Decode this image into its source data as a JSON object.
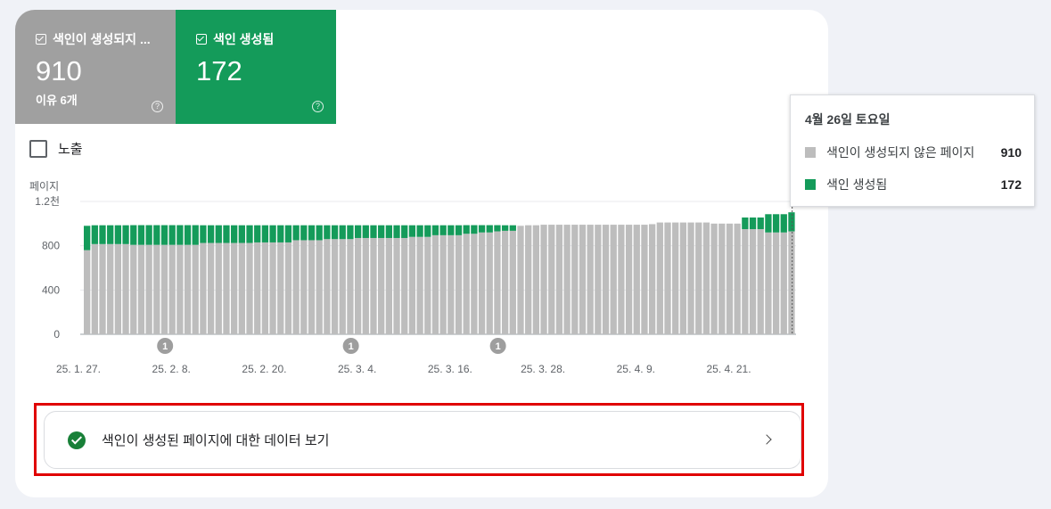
{
  "metrics": {
    "not_indexed": {
      "label": "색인이 생성되지 ...",
      "value": "910",
      "sub": "이유 6개",
      "help": "?"
    },
    "indexed": {
      "label": "색인 생성됨",
      "value": "172",
      "help": "?"
    }
  },
  "exposure_label": "노출",
  "chart_data": {
    "type": "bar",
    "stacked": true,
    "ylabel": "페이지",
    "ylim": [
      0,
      1200
    ],
    "yticks": [
      "0",
      "400",
      "800",
      "1.2천"
    ],
    "xticks": [
      "25. 1. 27.",
      "25. 2. 8.",
      "25. 2. 20.",
      "25. 3. 4.",
      "25. 3. 16.",
      "25. 3. 28.",
      "25. 4. 9.",
      "25. 4. 21."
    ],
    "annotation_marker": "1",
    "annotation_days": [
      10,
      34,
      53
    ],
    "start_label": "25. 1. 27.",
    "series": [
      {
        "name": "색인이 생성되지 않은 페이지",
        "color": "#bdbdbd",
        "values": [
          760,
          815,
          815,
          815,
          815,
          815,
          808,
          808,
          808,
          808,
          808,
          808,
          808,
          808,
          808,
          825,
          825,
          825,
          825,
          825,
          825,
          825,
          830,
          830,
          830,
          830,
          830,
          850,
          850,
          850,
          850,
          860,
          860,
          860,
          860,
          870,
          870,
          870,
          870,
          870,
          870,
          870,
          880,
          880,
          880,
          895,
          895,
          895,
          895,
          908,
          908,
          920,
          920,
          930,
          935,
          935,
          980,
          985,
          985,
          990,
          990,
          990,
          990,
          990,
          990,
          990,
          990,
          990,
          990,
          990,
          990,
          990,
          990,
          995,
          1010,
          1010,
          1010,
          1010,
          1010,
          1010,
          1010,
          1000,
          1000,
          1000,
          1000,
          950,
          950,
          950,
          920,
          920,
          920,
          930
        ]
      },
      {
        "name": "색인 생성됨",
        "color": "#149b5a",
        "values": [
          220,
          170,
          170,
          170,
          170,
          170,
          178,
          178,
          178,
          178,
          178,
          178,
          178,
          178,
          178,
          160,
          160,
          160,
          160,
          160,
          160,
          160,
          155,
          155,
          155,
          155,
          155,
          135,
          135,
          135,
          135,
          125,
          125,
          125,
          125,
          115,
          115,
          115,
          115,
          115,
          115,
          115,
          105,
          105,
          105,
          90,
          90,
          90,
          90,
          78,
          78,
          66,
          66,
          56,
          50,
          50,
          0,
          0,
          0,
          0,
          0,
          0,
          0,
          0,
          0,
          0,
          0,
          0,
          0,
          0,
          0,
          0,
          0,
          0,
          0,
          0,
          0,
          0,
          0,
          0,
          0,
          0,
          0,
          0,
          0,
          105,
          105,
          105,
          165,
          165,
          165,
          172
        ]
      }
    ]
  },
  "link": {
    "label": "색인이 생성된 페이지에 대한 데이터 보기"
  },
  "tooltip": {
    "date": "4월 26일 토요일",
    "rows": [
      {
        "label": "색인이 생성되지 않은 페이지",
        "value": "910",
        "color": "#bdbdbd"
      },
      {
        "label": "색인 생성됨",
        "value": "172",
        "color": "#149b5a"
      }
    ]
  }
}
